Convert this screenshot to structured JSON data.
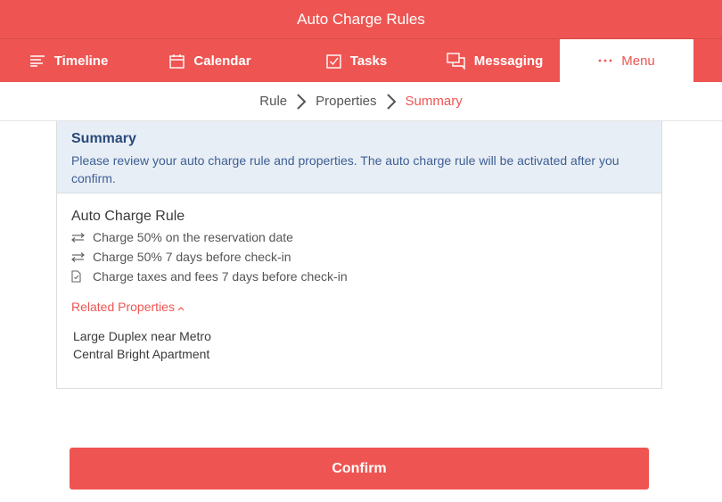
{
  "header": {
    "title": "Auto Charge Rules"
  },
  "nav": {
    "tabs": [
      {
        "label": "Timeline",
        "icon": "timeline-icon"
      },
      {
        "label": "Calendar",
        "icon": "calendar-icon"
      },
      {
        "label": "Tasks",
        "icon": "tasks-icon"
      },
      {
        "label": "Messaging",
        "icon": "messaging-icon"
      },
      {
        "label": "Menu",
        "icon": "more-icon",
        "active": true
      }
    ]
  },
  "breadcrumb": {
    "steps": [
      "Rule",
      "Properties",
      "Summary"
    ],
    "active_index": 2
  },
  "summary": {
    "title": "Summary",
    "description": "Please review your auto charge rule and properties. The auto charge rule will be activated after you confirm."
  },
  "rule": {
    "title": "Auto Charge Rule",
    "lines": [
      {
        "icon": "transfer-icon",
        "text": "Charge 50% on the reservation date"
      },
      {
        "icon": "transfer-icon",
        "text": "Charge 50% 7 days before check-in"
      },
      {
        "icon": "document-icon",
        "text": "Charge taxes and fees 7 days before check-in"
      }
    ],
    "related_label": "Related Properties",
    "properties": [
      "Large Duplex near Metro",
      "Central Bright Apartment"
    ]
  },
  "actions": {
    "confirm_label": "Confirm"
  },
  "colors": {
    "accent": "#ee5552",
    "summary_bg": "#e8eef5",
    "summary_text": "#3d5f94"
  }
}
